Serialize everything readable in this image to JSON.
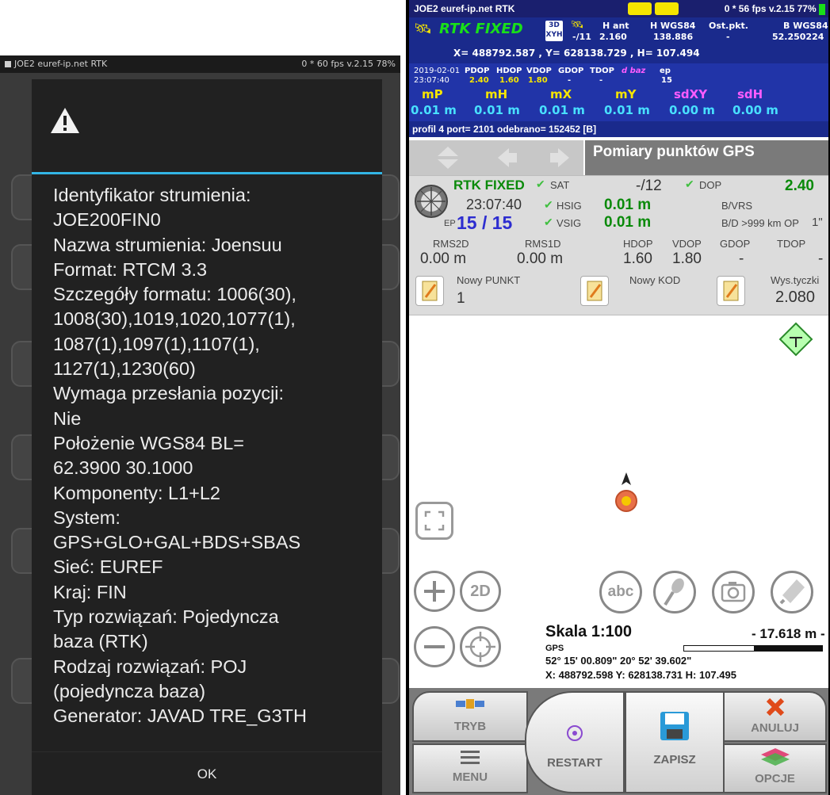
{
  "left_screen": {
    "status_title": "JOE2 euref-ip.net RTK",
    "status_right": "0 * 60 fps  v.2.15  78%",
    "dialog_lines": [
      "Identyfikator strumienia:",
      "JOE200FIN0",
      "Nazwa strumienia: Joensuu",
      "Format: RTCM 3.3",
      "Szczegóły formatu: 1006(30),",
      "1008(30),1019,1020,1077(1),",
      "1087(1),1097(1),1107(1),",
      "1127(1),1230(60)",
      "Wymaga przesłania pozycji:",
      "Nie",
      "Położenie WGS84 BL=",
      "62.3900 30.1000",
      "Komponenty: L1+L2",
      "System:",
      "GPS+GLO+GAL+BDS+SBAS",
      "Sieć: EUREF",
      "Kraj: FIN",
      "Typ rozwiązań: Pojedyncza",
      "baza (RTK)",
      "Rodzaj rozwiązań: POJ",
      "(pojedyncza baza)",
      "Generator: JAVAD TRE_G3TH"
    ],
    "ok_label": "OK"
  },
  "right_screen": {
    "status_title": "JOE2 euref-ip.net RTK",
    "status_right": "0 * 56 fps  v.2.15  77%",
    "rtk_label": "RTK FIXED",
    "mode_3d": "3D",
    "mode_xyh": "XYH",
    "sats": "-/11",
    "h_ant_label": "H ant",
    "h_ant_value": "2.160",
    "h_wgs_label": "H WGS84",
    "h_wgs_value": "138.886",
    "ost_label": "Ost.pkt.",
    "ost_value": "-",
    "b_wgs_label": "B WGS84",
    "b_wgs_value": "52.250224",
    "coords_line": "X= 488792.587 , Y= 628138.729 , H= 107.494",
    "date": "2019-02-01",
    "time": "23:07:40",
    "dop_headers": [
      "PDOP",
      "HDOP",
      "VDOP",
      "GDOP",
      "TDOP",
      "d baz",
      "ep"
    ],
    "dop_values": [
      "2.40",
      "1.60",
      "1.80",
      "-",
      "-",
      "",
      "15"
    ],
    "acc_headers": [
      "mP",
      "mH",
      "mX",
      "mY",
      "sdXY",
      "sdH"
    ],
    "acc_values": [
      "0.01 m",
      "0.01 m",
      "0.01 m",
      "0.01 m",
      "0.00 m",
      "0.00 m"
    ],
    "profile_line": "profil 4 port= 2101 odebrano= 152452 [B]",
    "nav_title": "Pomiary punktów GPS",
    "panel": {
      "rtk_fixed": "RTK FIXED",
      "sat_label": "SAT",
      "sat_value": "-/12",
      "dop_label": "DOP",
      "dop_value": "2.40",
      "time": "23:07:40",
      "hsig_label": "HSIG",
      "hsig_value": "0.01 m",
      "bvrs_label": "B/VRS",
      "ep_label": "EP",
      "ep_value": "15 / 15",
      "vsig_label": "VSIG",
      "vsig_value": "0.01 m",
      "bd_label": "B/D >999 km OP",
      "op_value": "1\"",
      "rms2d_label": "RMS2D",
      "rms1d_label": "RMS1D",
      "hdop_label": "HDOP",
      "vdop_label": "VDOP",
      "gdop_label": "GDOP",
      "tdop_label": "TDOP",
      "rms2d_value": "0.00 m",
      "rms1d_value": "0.00 m",
      "hdop_value": "1.60",
      "vdop_value": "1.80",
      "gdop_value": "-",
      "tdop_value": "-",
      "new_point_label": "Nowy PUNKT",
      "new_point_value": "1",
      "new_code_label": "Nowy KOD",
      "pole_label": "Wys.tyczki",
      "pole_value": "2.080"
    },
    "map": {
      "btn_2d": "2D",
      "btn_abc": "abc",
      "scale_label": "Skala 1:100",
      "scale_distance": "- 17.618 m -",
      "gps_label": "GPS",
      "latlon": "52° 15' 00.809\" 20° 52' 39.602\"",
      "xyh": "X: 488792.598  Y: 628138.731  H: 107.495"
    },
    "bottom": {
      "tryb": "TRYB",
      "menu": "MENU",
      "restart": "RESTART",
      "zapisz": "ZAPISZ",
      "anuluj": "ANULUJ",
      "opcje": "OPCJE"
    },
    "colors": {
      "header_blue": "#1a2a8c",
      "rtk_green": "#19e019",
      "yellow": "#f5e500",
      "cyan": "#48e0ff",
      "magenta": "#ff5cff"
    }
  }
}
